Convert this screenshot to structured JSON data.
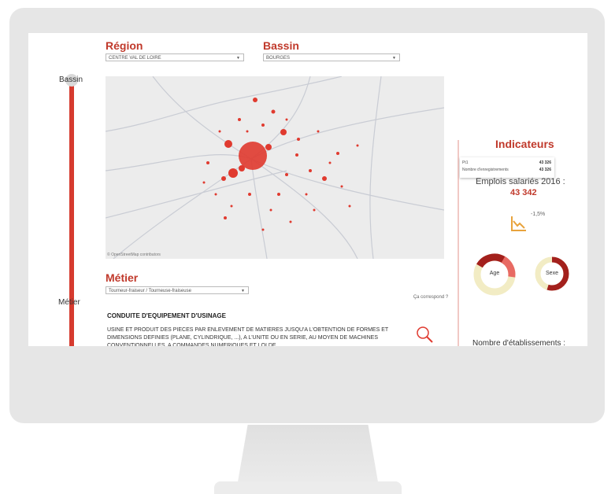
{
  "header": {
    "region_title": "Région",
    "region_value": "CENTRE VAL DE LOIRE",
    "bassin_title": "Bassin",
    "bassin_value": "BOURGES"
  },
  "timeline": {
    "bassin_label": "Bassin",
    "metier_label": "Métier"
  },
  "map": {
    "credit": "© OpenStreetMap contributors",
    "colors": {
      "dot": "#e03a2f",
      "road": "#c9ccd4",
      "bg": "#ececec"
    }
  },
  "metier": {
    "title": "Métier",
    "select_value": "Tourneur-fraiseur / Tourneuse-fraiseuse",
    "heading": "CONDUITE D'EQUIPEMENT D'USINAGE",
    "description": "USINE ET PRODUIT DES PIECES PAR ENLEVEMENT DE MATIERES JUSQU'A L'OBTENTION DE FORMES ET DIMENSIONS DEFINIES (PLANE, CYLINDRIQUE, ...), A L'UNITE OU EN SERIE, AU MOYEN DE MACHINES CONVENTIONNELLES, A COMMANDES NUMERIQUES ET LOI DE",
    "correspond": "Ça correspond ?"
  },
  "indicateurs": {
    "title": "Indicateurs",
    "tooltip": {
      "row1_label": "Pt1",
      "row1_value": "43 326",
      "row2_label": "Nombre d'enregistrements",
      "row2_value": "43 326"
    },
    "emplois_label": "Emplois salariés 2016 :",
    "emplois_value": "43 342",
    "trend": "-1,5%",
    "age_label": "Age",
    "sexe_label": "Sexe",
    "etablissements_label": "Nombre d'établissements :",
    "colors": {
      "accent": "#c0392b",
      "trend": "#e8a33c",
      "donut_dark": "#a3201c",
      "donut_light": "#e86a63",
      "donut_bg": "#f2ecc4"
    }
  }
}
